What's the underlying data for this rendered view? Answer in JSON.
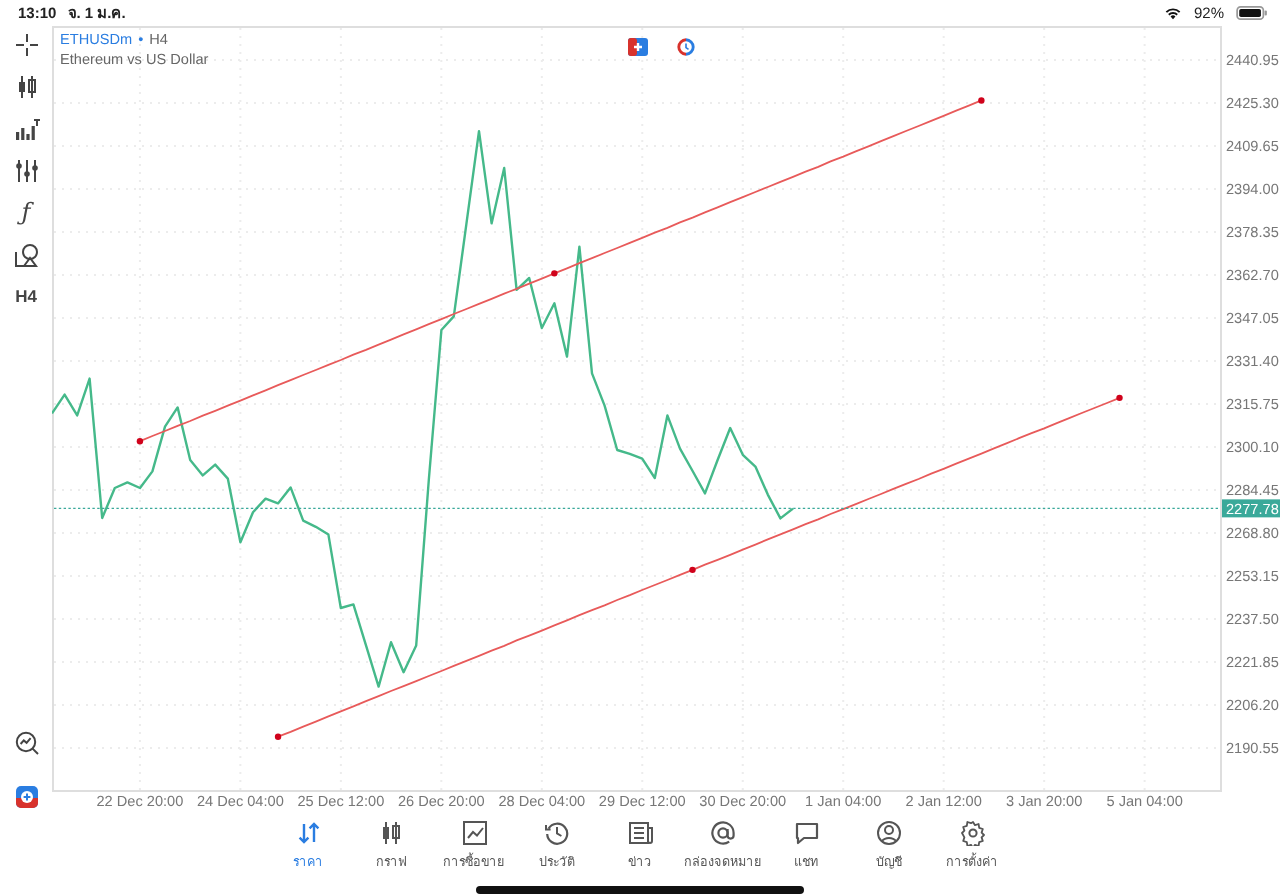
{
  "status_bar": {
    "time": "13:10",
    "date": "จ. 1 ม.ค.",
    "battery": "92%"
  },
  "left_toolbar": {
    "function_symbol": "ƒ",
    "timeframe": "H4"
  },
  "chart_header": {
    "separator": "•",
    "timeframe": "H4",
    "description": "Ethereum vs US Dollar"
  },
  "chart": {
    "chart_data": {
      "type": "line",
      "categories": [
        null,
        null,
        null,
        null,
        null,
        null,
        null,
        "22 Dec 20:00",
        null,
        null,
        null,
        null,
        null,
        null,
        null,
        "24 Dec 04:00",
        null,
        null,
        null,
        null,
        null,
        null,
        null,
        "25 Dec 12:00",
        null,
        null,
        null,
        null,
        null,
        null,
        null,
        "26 Dec 20:00",
        null,
        null,
        null,
        null,
        null,
        null,
        null,
        "28 Dec 04:00",
        null,
        null,
        null,
        null,
        null,
        null,
        null,
        "29 Dec 12:00",
        null,
        null,
        null,
        null,
        null,
        null,
        null,
        "30 Dec 20:00",
        null,
        null,
        null,
        null,
        null,
        null,
        null,
        "1 Jan 04:00",
        null,
        null,
        null,
        null,
        null,
        null,
        null,
        "2 Jan 12:00",
        null,
        null,
        null,
        null,
        null,
        null,
        null,
        "3 Jan 20:00",
        null,
        null,
        null,
        null,
        null,
        null,
        null,
        "5 Jan 04:00",
        null,
        null,
        null,
        null,
        null
      ],
      "series": [
        {
          "name": "ETHUSDm",
          "color": "#45b98a",
          "values": [
            2312.3,
            2319.2,
            2311.6,
            2325.0,
            2274.3,
            2285.2,
            2287.2,
            2285.2,
            2291.2,
            2307.5,
            2314.5,
            2295.4,
            2289.8,
            2293.7,
            2288.6,
            2265.5,
            2276.4,
            2281.3,
            2279.6,
            2285.4,
            2273.3,
            2271.1,
            2268.2,
            2241.5,
            2242.8,
            2227.9,
            2212.9,
            2229.1,
            2218.2,
            2227.9,
            2288.1,
            2342.7,
            2347.6,
            2381.3,
            2415.0,
            2381.5,
            2401.6,
            2357.3,
            2361.6,
            2343.4,
            2352.4,
            2333.0,
            2373.0,
            2326.9,
            2315.2,
            2299.0,
            2297.6,
            2295.9,
            2288.8,
            2311.6,
            2299.5,
            2291.4,
            2283.2,
            2295.4,
            2307.0,
            2297.3,
            2293.0,
            2282.8,
            2274.1,
            2277.7,
            null,
            null,
            null,
            null,
            null,
            null,
            null,
            null,
            null,
            null,
            null,
            null,
            null,
            null,
            null,
            null,
            null,
            null,
            null,
            null,
            null,
            null,
            null,
            null,
            null,
            null,
            null,
            null,
            null,
            null,
            null,
            null,
            null
          ]
        },
        {
          "color": "#e85a5a",
          "values": [
            null,
            null,
            null,
            null,
            null,
            null,
            null,
            2302.2,
            2304.1,
            2305.9,
            2307.8,
            2309.6,
            2311.5,
            2313.3,
            2315.2,
            2317.0,
            2318.9,
            2320.7,
            2322.6,
            2324.4,
            2326.3,
            2328.1,
            2330.0,
            2331.8,
            2333.7,
            2335.5,
            2337.4,
            2339.2,
            2341.1,
            2342.9,
            2344.8,
            2346.6,
            2348.5,
            2350.3,
            2352.2,
            2354.0,
            2355.9,
            2357.7,
            2359.6,
            2361.4,
            2363.3,
            2365.1,
            2367.0,
            2368.8,
            2370.7,
            2372.5,
            2374.4,
            2376.2,
            2378.1,
            2379.9,
            2381.8,
            2383.6,
            2385.5,
            2387.3,
            2389.2,
            2391.0,
            2392.9,
            2394.7,
            2396.6,
            2398.4,
            2400.3,
            2402.1,
            2404.0,
            2405.8,
            2407.7,
            2409.5,
            2411.4,
            2413.2,
            2415.1,
            2416.9,
            2418.8,
            2420.6,
            2422.5,
            2424.3,
            2426.2,
            null,
            null,
            null,
            null,
            null,
            null,
            null,
            null,
            null,
            null,
            null,
            null,
            null,
            null,
            null,
            null,
            null,
            null
          ]
        },
        {
          "color": "#e85a5a",
          "values": [
            null,
            null,
            null,
            null,
            null,
            null,
            null,
            null,
            null,
            null,
            null,
            null,
            null,
            null,
            null,
            null,
            null,
            null,
            2194.7,
            2196.5,
            2198.4,
            2200.2,
            2202.1,
            2203.9,
            2205.7,
            2207.6,
            2209.4,
            2211.3,
            2213.1,
            2214.9,
            2216.8,
            2218.6,
            2220.5,
            2222.3,
            2224.1,
            2226.0,
            2227.8,
            2229.7,
            2231.5,
            2233.3,
            2235.2,
            2237.0,
            2238.9,
            2240.7,
            2242.5,
            2244.4,
            2246.2,
            2248.1,
            2249.9,
            2251.7,
            2253.6,
            2255.4,
            2257.3,
            2259.1,
            2260.9,
            2262.8,
            2264.6,
            2266.5,
            2268.3,
            2270.1,
            2272.0,
            2273.8,
            2275.7,
            2277.5,
            2279.3,
            2281.2,
            2283.0,
            2284.9,
            2286.7,
            2288.5,
            2290.4,
            2292.2,
            2294.1,
            2295.9,
            2297.7,
            2299.6,
            2301.4,
            2303.3,
            2305.1,
            2306.9,
            2308.8,
            2310.6,
            2312.5,
            2314.3,
            2316.1,
            2318.0,
            null,
            null,
            null,
            null,
            null,
            null,
            null
          ]
        }
      ],
      "ylim": [
        2175.3,
        2453.3
      ],
      "grid": true,
      "yticks": [
        {
          "value": 2440.95,
          "label": "2440.95"
        },
        {
          "value": 2425.3,
          "label": "2425.30"
        },
        {
          "value": 2409.65,
          "label": "2409.65"
        },
        {
          "value": 2394.0,
          "label": "2394.00"
        },
        {
          "value": 2378.35,
          "label": "2378.35"
        },
        {
          "value": 2362.7,
          "label": "2362.70"
        },
        {
          "value": 2347.05,
          "label": "2347.05"
        },
        {
          "value": 2331.4,
          "label": "2331.40"
        },
        {
          "value": 2315.75,
          "label": "2315.75"
        },
        {
          "value": 2300.1,
          "label": "2300.10"
        },
        {
          "value": 2284.45,
          "label": "2284.45"
        },
        {
          "value": 2268.8,
          "label": "2268.80"
        },
        {
          "value": 2253.15,
          "label": "2253.15"
        },
        {
          "value": 2237.5,
          "label": "2237.50"
        },
        {
          "value": 2221.85,
          "label": "2221.85"
        },
        {
          "value": 2206.2,
          "label": "2206.20"
        },
        {
          "value": 2190.55,
          "label": "2190.55"
        }
      ],
      "ref_lines": [
        {
          "axis": "y",
          "value": 2277.78,
          "label": "2277.78",
          "color": "#3aa99a"
        }
      ]
    }
  },
  "tabs": [
    {
      "label": "ราคา",
      "selected": true
    },
    {
      "label": "กราฟ",
      "selected": false
    },
    {
      "label": "การซื้อขาย",
      "selected": false
    },
    {
      "label": "ประวัติ",
      "selected": false
    },
    {
      "label": "ข่าว",
      "selected": false
    },
    {
      "label": "กล่องจดหมาย",
      "selected": false
    },
    {
      "label": "แชท",
      "selected": false
    },
    {
      "label": "บัญชี",
      "selected": false
    },
    {
      "label": "การตั้งค่า",
      "selected": false
    }
  ]
}
